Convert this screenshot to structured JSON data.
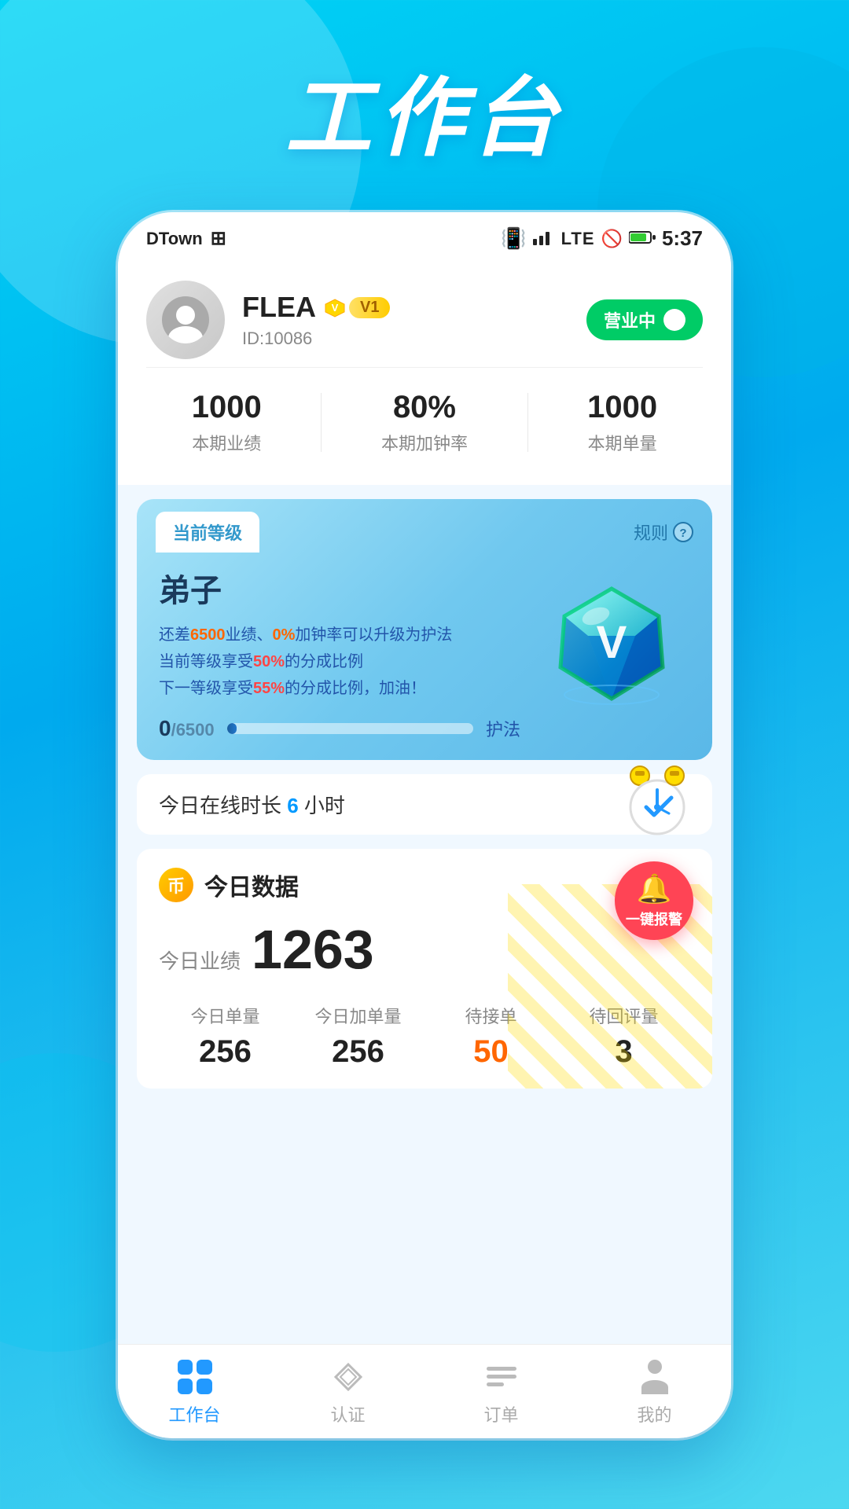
{
  "page": {
    "title": "工作台",
    "background_gradient": "linear-gradient(160deg, #00d4f5, #4dd8f0)"
  },
  "status_bar": {
    "app_name": "DTown",
    "time": "5:37",
    "lte_label": "LTE"
  },
  "profile": {
    "name": "FLEA",
    "level_label": "V1",
    "id_label": "ID:10086",
    "business_status": "营业中"
  },
  "stats": [
    {
      "label": "本期业绩",
      "value": "1000"
    },
    {
      "label": "本期加钟率",
      "value": "80%"
    },
    {
      "label": "本期单量",
      "value": "1000"
    }
  ],
  "level_card": {
    "header_tab": "当前等级",
    "rules_label": "规则",
    "level_name": "弟子",
    "desc_line1": "还差6500业绩、0%加钟率可以升级为护法",
    "desc_line1_prefix": "还差",
    "desc_gap": "6500",
    "desc_mid1": "业绩、",
    "desc_highlight2": "0%",
    "desc_mid2": "加钟率可以升级为护法",
    "desc_line2_prefix": "当前等级享受",
    "desc_line2_highlight": "50%",
    "desc_line2_suffix": "的分成比例",
    "desc_line3_prefix": "下一等级享受",
    "desc_line3_highlight": "55%",
    "desc_line3_suffix": "的分成比例，加油！",
    "progress_current": "0",
    "progress_max": "6500",
    "progress_next_label": "护法",
    "progress_percent": 4
  },
  "online_time": {
    "prefix": "今日在线时长",
    "hours": "6",
    "suffix": "小时"
  },
  "today_data": {
    "section_title": "今日数据",
    "alert_label": "一键报警",
    "perf_label": "今日业绩",
    "perf_value": "1263",
    "stats": [
      {
        "label": "今日单量",
        "value": "256",
        "orange": false
      },
      {
        "label": "今日加单量",
        "value": "256",
        "orange": false
      },
      {
        "label": "待接单",
        "value": "50",
        "orange": true
      },
      {
        "label": "待回评量",
        "value": "3",
        "orange": false
      }
    ]
  },
  "nav": [
    {
      "label": "工作台",
      "active": true,
      "icon": "grid"
    },
    {
      "label": "认证",
      "active": false,
      "icon": "diamond"
    },
    {
      "label": "订单",
      "active": false,
      "icon": "list"
    },
    {
      "label": "我的",
      "active": false,
      "icon": "person"
    }
  ]
}
